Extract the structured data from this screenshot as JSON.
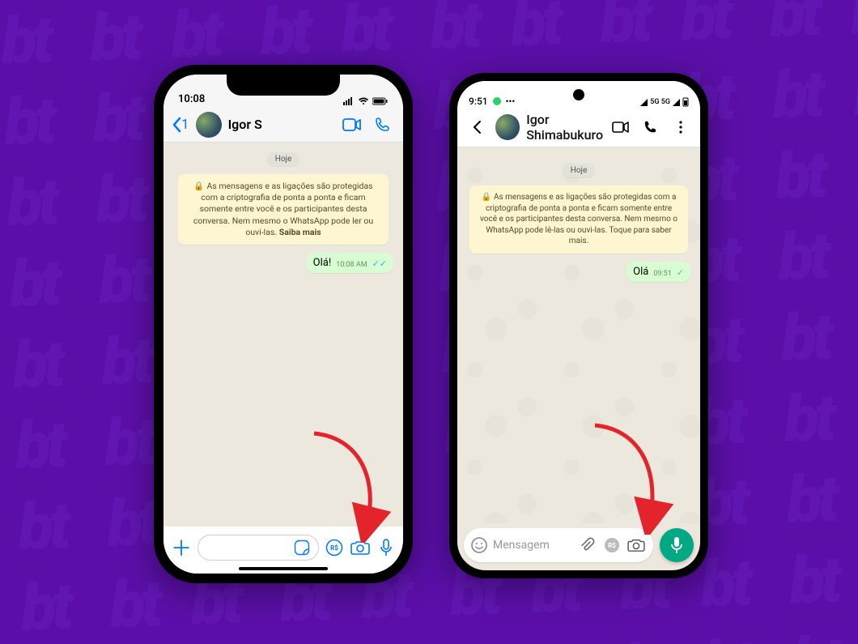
{
  "ios": {
    "status": {
      "time": "10:08",
      "network": "●●●●",
      "wifi": "wifi",
      "battery": "batt"
    },
    "header": {
      "back_count": "1",
      "contact_name": "Igor S"
    },
    "chat": {
      "date_label": "Hoje",
      "encryption_notice": "As mensagens e as ligações são protegidas com a criptografia de ponta a ponta e ficam somente entre você e os participantes desta conversa. Nem mesmo o WhatsApp pode ler ou ouvi-las.",
      "encryption_learn_more": "Saiba mais",
      "message": {
        "text": "Olá!",
        "time": "10:08 AM"
      }
    },
    "composer": {
      "rs_label": "R$"
    }
  },
  "android": {
    "status": {
      "time": "9:51",
      "net_labels": "5G  5G"
    },
    "header": {
      "contact_name": "Igor Shimabukuro"
    },
    "chat": {
      "date_label": "Hoje",
      "encryption_notice": "As mensagens e as ligações são protegidas com a criptografia de ponta a ponta e ficam somente entre você e os participantes desta conversa. Nem mesmo o WhatsApp pode lê-las ou ouvi-las. Toque para saber mais.",
      "message": {
        "text": "Olá",
        "time": "09:51"
      }
    },
    "composer": {
      "placeholder": "Mensagem",
      "rs_label": "R$"
    }
  }
}
